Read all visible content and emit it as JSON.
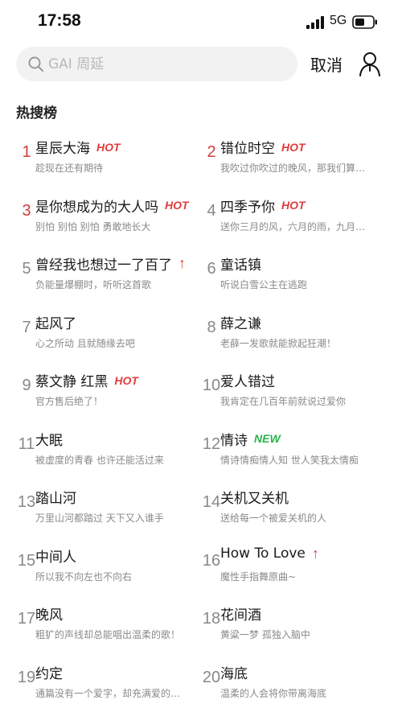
{
  "status": {
    "time": "17:58",
    "network": "5G"
  },
  "search": {
    "placeholder": "GAI 周延",
    "cancel_label": "取消"
  },
  "section": {
    "title": "热搜榜"
  },
  "colors": {
    "hot": "#e03c3c",
    "new": "#2bb24c",
    "top_rank": "#d63b3b"
  },
  "items": [
    {
      "rank": "1",
      "title": "星辰大海",
      "badge": "HOT",
      "badge_type": "hot",
      "desc": "趁现在还有期待"
    },
    {
      "rank": "2",
      "title": "错位时空",
      "badge": "HOT",
      "badge_type": "hot",
      "desc": "我吹过你吹过的晚风，那我们算…"
    },
    {
      "rank": "3",
      "title": "是你想成为的大人吗",
      "badge": "HOT",
      "badge_type": "hot",
      "desc": "别怕 别怕 别怕 勇敢地长大"
    },
    {
      "rank": "4",
      "title": "四季予你",
      "badge": "HOT",
      "badge_type": "hot",
      "desc": "送你三月的风，六月的雨，九月…"
    },
    {
      "rank": "5",
      "title": "曾经我也想过一了百了",
      "badge": "↑",
      "badge_type": "up",
      "desc": "负能量爆棚时，听听这首歌"
    },
    {
      "rank": "6",
      "title": "童话镇",
      "badge": "",
      "badge_type": "",
      "desc": "听说白雪公主在逃跑"
    },
    {
      "rank": "7",
      "title": "起风了",
      "badge": "",
      "badge_type": "",
      "desc": "心之所动 且就随缘去吧"
    },
    {
      "rank": "8",
      "title": "薛之谦",
      "badge": "",
      "badge_type": "",
      "desc": "老薛一发歌就能掀起狂潮！"
    },
    {
      "rank": "9",
      "title": "蔡文静 红黑",
      "badge": "HOT",
      "badge_type": "hot",
      "desc": "官方售后绝了！"
    },
    {
      "rank": "10",
      "title": "爱人错过",
      "badge": "",
      "badge_type": "",
      "desc": "我肯定在几百年前就说过爱你"
    },
    {
      "rank": "11",
      "title": "大眠",
      "badge": "",
      "badge_type": "",
      "desc": "被虚度的青春 也许还能活过来"
    },
    {
      "rank": "12",
      "title": "情诗",
      "badge": "NEW",
      "badge_type": "new",
      "desc": "情诗情痴情人知 世人笑我太情痴"
    },
    {
      "rank": "13",
      "title": "踏山河",
      "badge": "",
      "badge_type": "",
      "desc": "万里山河都踏过 天下又入谁手"
    },
    {
      "rank": "14",
      "title": "关机又关机",
      "badge": "",
      "badge_type": "",
      "desc": "送给每一个被爱关机的人"
    },
    {
      "rank": "15",
      "title": "中间人",
      "badge": "",
      "badge_type": "",
      "desc": "所以我不向左也不向右"
    },
    {
      "rank": "16",
      "title": "How To Love",
      "badge": "↑",
      "badge_type": "up",
      "desc": "魔性手指舞原曲~"
    },
    {
      "rank": "17",
      "title": "晚风",
      "badge": "",
      "badge_type": "",
      "desc": "粗犷的声线却总能唱出温柔的歌！"
    },
    {
      "rank": "18",
      "title": "花间酒",
      "badge": "",
      "badge_type": "",
      "desc": "黄粱一梦 孤独入脑中"
    },
    {
      "rank": "19",
      "title": "约定",
      "badge": "",
      "badge_type": "",
      "desc": "通篇没有一个爱字，却充满爱的…"
    },
    {
      "rank": "20",
      "title": "海底",
      "badge": "",
      "badge_type": "",
      "desc": "温柔的人会将你带离海底"
    }
  ]
}
